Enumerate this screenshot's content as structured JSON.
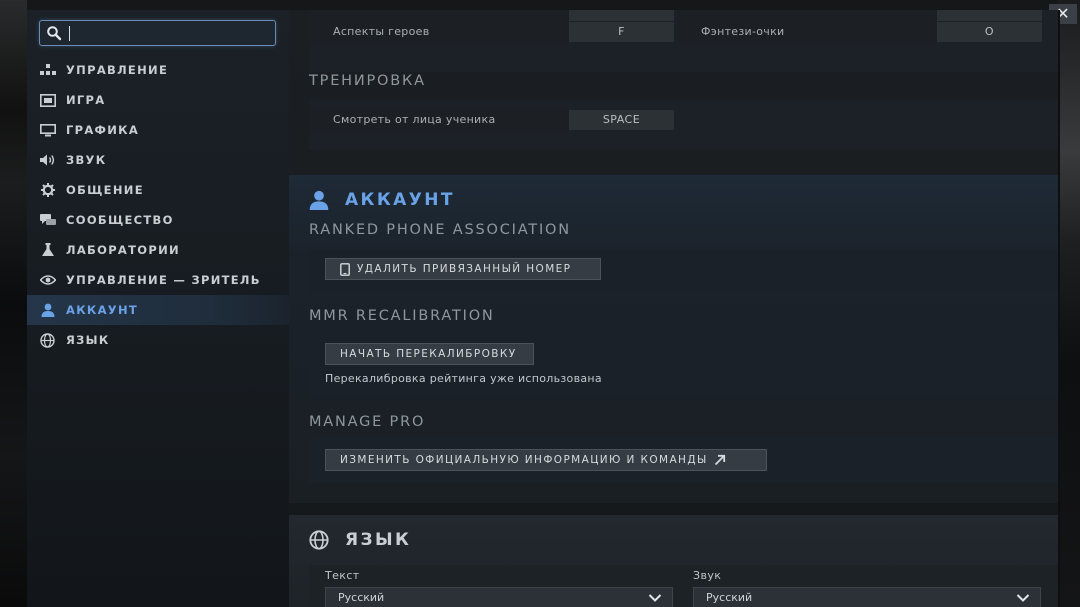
{
  "window": {
    "close_glyph": "✕"
  },
  "search": {
    "value": "",
    "placeholder": ""
  },
  "sidebar": {
    "items": [
      {
        "label": "УПРАВЛЕНИЕ",
        "icon": "controls-icon"
      },
      {
        "label": "ИГРА",
        "icon": "game-icon"
      },
      {
        "label": "ГРАФИКА",
        "icon": "monitor-icon"
      },
      {
        "label": "ЗВУК",
        "icon": "speaker-icon"
      },
      {
        "label": "ОБЩЕНИЕ",
        "icon": "gear-icon"
      },
      {
        "label": "СООБЩЕСТВО",
        "icon": "chat-icon"
      },
      {
        "label": "ЛАБОРАТОРИИ",
        "icon": "flask-icon"
      },
      {
        "label": "УПРАВЛЕНИЕ — ЗРИТЕЛЬ",
        "icon": "eye-icon"
      },
      {
        "label": "АККАУНТ",
        "icon": "user-icon",
        "active": true
      },
      {
        "label": "ЯЗЫК",
        "icon": "globe-icon"
      }
    ]
  },
  "training": {
    "partial_row": {
      "left_label": "Аспекты героев",
      "left_key": "F",
      "right_label": "Фэнтези-очки",
      "right_key": "O"
    },
    "title": "ТРЕНИРОВКА",
    "row": {
      "label": "Смотреть от лица ученика",
      "key": "SPACE"
    }
  },
  "account": {
    "heading": "АККАУНТ",
    "phone": {
      "title": "RANKED PHONE ASSOCIATION",
      "button": "УДАЛИТЬ ПРИВЯЗАННЫЙ НОМЕР"
    },
    "mmr": {
      "title": "MMR RECALIBRATION",
      "button": "НАЧАТЬ ПЕРЕКАЛИБРОВКУ",
      "note": "Перекалибровка рейтинга уже использована"
    },
    "pro": {
      "title": "MANAGE PRO",
      "button": "ИЗМЕНИТЬ ОФИЦИАЛЬНУЮ ИНФОРМАЦИЮ И КОМАНДЫ"
    }
  },
  "language": {
    "heading": "ЯЗЫК",
    "text_label": "Текст",
    "text_value": "Русский",
    "audio_label": "Звук",
    "audio_value": "Русский"
  },
  "colors": {
    "accent": "#6aa2e8",
    "active_nav_bg": "#25364a"
  }
}
